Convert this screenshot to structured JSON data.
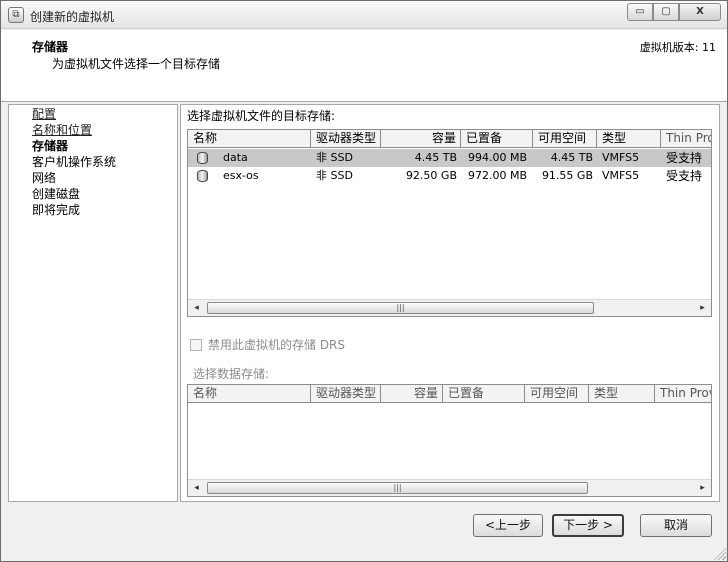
{
  "window": {
    "title": "创建新的虚拟机",
    "controls": {
      "minimize": "▭",
      "maximize": "▢",
      "close": "X"
    }
  },
  "header": {
    "title": "存储器",
    "subtitle": "为虚拟机文件选择一个目标存储",
    "version_label": "虚拟机版本: 11"
  },
  "nav": {
    "items": [
      {
        "label": "配置",
        "state": "visited"
      },
      {
        "label": "名称和位置",
        "state": "visited"
      },
      {
        "label": "存储器",
        "state": "current"
      },
      {
        "label": "客户机操作系统",
        "state": "upcoming"
      },
      {
        "label": "网络",
        "state": "upcoming"
      },
      {
        "label": "创建磁盘",
        "state": "upcoming"
      },
      {
        "label": "即将完成",
        "state": "upcoming"
      }
    ]
  },
  "main": {
    "heading": "选择虚拟机文件的目标存储:",
    "storage_table": {
      "columns": [
        "名称",
        "驱动器类型",
        "容量",
        "已置备",
        "可用空间",
        "类型",
        "Thin Pro"
      ],
      "rows": [
        {
          "name": "data",
          "drive_type": "非 SSD",
          "capacity": "4.45 TB",
          "provisioned": "994.00 MB",
          "free": "4.45 TB",
          "type": "VMFS5",
          "thin": "受支持",
          "selected": true
        },
        {
          "name": "esx-os",
          "drive_type": "非 SSD",
          "capacity": "92.50 GB",
          "provisioned": "972.00 MB",
          "free": "91.55 GB",
          "type": "VMFS5",
          "thin": "受支持",
          "selected": false
        }
      ]
    },
    "drs_checkbox": {
      "label": "禁用此虚拟机的存储 DRS",
      "checked": false,
      "enabled": false
    },
    "datastore_label": "选择数据存储:",
    "datastore_table": {
      "columns": [
        "名称",
        "驱动器类型",
        "容量",
        "已置备",
        "可用空间",
        "类型",
        "Thin Provi"
      ]
    },
    "scrollbar": {
      "left": "◂",
      "right": "▸",
      "grip": "|||"
    }
  },
  "footer": {
    "back_label": "<上一步",
    "next_label": "下一步 >",
    "cancel_label": "取消"
  }
}
